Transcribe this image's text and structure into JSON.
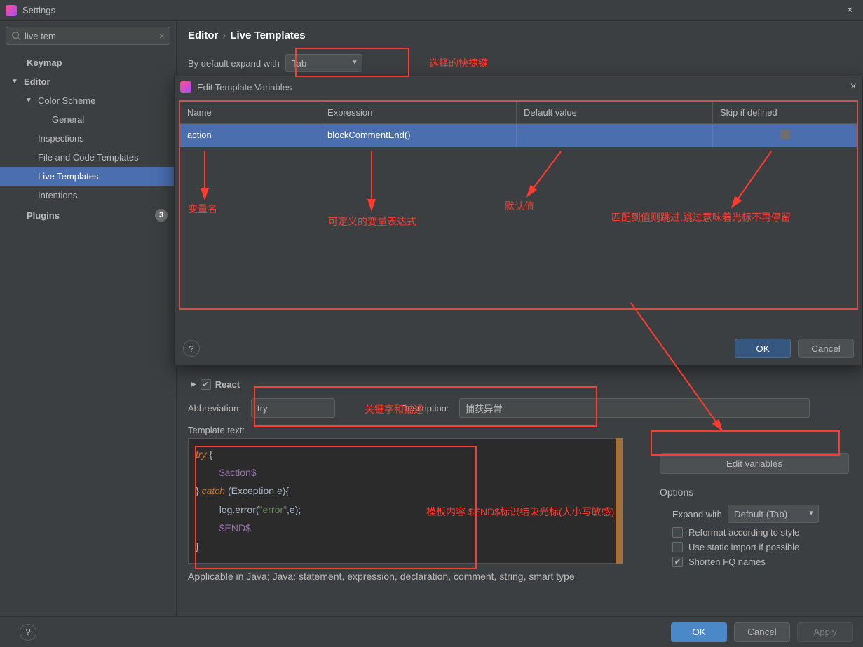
{
  "window": {
    "title": "Settings"
  },
  "search": {
    "value": "live tem",
    "placeholder": ""
  },
  "tree": {
    "keymap": "Keymap",
    "editor": "Editor",
    "color_scheme": "Color Scheme",
    "general": "General",
    "inspections": "Inspections",
    "file_code_templates": "File and Code Templates",
    "live_templates": "Live Templates",
    "intentions": "Intentions",
    "plugins": "Plugins",
    "plugins_badge": "3"
  },
  "breadcrumb": {
    "a": "Editor",
    "b": "Live Templates"
  },
  "expand_default": {
    "label": "By default expand with",
    "value": "Tab"
  },
  "react_item": "React",
  "abbrev": {
    "label": "Abbreviation:",
    "value": "try"
  },
  "desc": {
    "label": "Description:",
    "value": "捕获异常"
  },
  "template_label": "Template text:",
  "template_lines": {
    "l1_kw": "try",
    "l1_rest": " {",
    "l2_var": "$action$",
    "l3_close": "}",
    "l3_kw": " catch ",
    "l3_rest": "(Exception e){",
    "l4_a": "log.error(",
    "l4_str": "\"error\"",
    "l4_b": ",e);",
    "l5_var": "$END$",
    "l6": "}"
  },
  "edit_vars_btn": "Edit variables",
  "options": {
    "title": "Options",
    "expand_label": "Expand with",
    "expand_value": "Default (Tab)",
    "reformat": "Reformat according to style",
    "static_import": "Use static import if possible",
    "shorten": "Shorten FQ names"
  },
  "applicable": "Applicable in Java; Java: statement, expression, declaration, comment, string, smart type",
  "footer": {
    "ok": "OK",
    "cancel": "Cancel",
    "apply": "Apply"
  },
  "modal": {
    "title": "Edit Template Variables",
    "cols": {
      "name": "Name",
      "expr": "Expression",
      "def": "Default value",
      "skip": "Skip if defined"
    },
    "row": {
      "name": "action",
      "expr": "blockCommentEnd()",
      "def": "",
      "skip": ""
    },
    "ok": "OK",
    "cancel": "Cancel"
  },
  "annotations": {
    "shortcut": "选择的快捷键",
    "varname": "变量名",
    "expr": "可定义的变量表达式",
    "def": "默认值",
    "skip": "匹配到值则跳过,跳过意味着光标不再停留",
    "keyword": "关键字和描述",
    "template": "模板内容 $END$标识结束光标(大小写敏感)"
  },
  "colors": {
    "red": "#ff3b30",
    "accent": "#4b6eaf"
  }
}
